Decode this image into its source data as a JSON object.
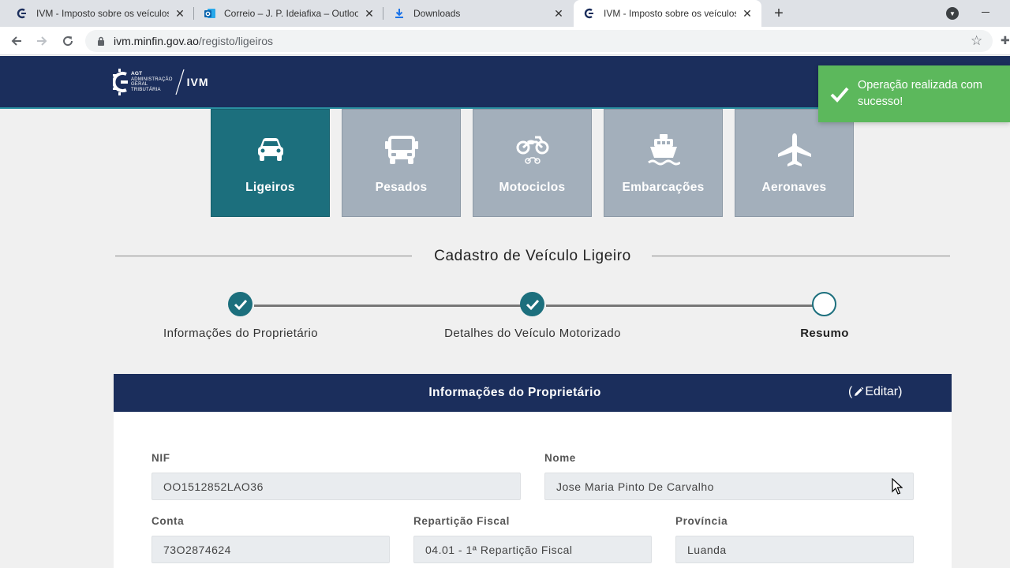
{
  "browser": {
    "tabs": [
      {
        "title": "IVM - Imposto sobre os veículos",
        "icon": "site-favicon",
        "active": false
      },
      {
        "title": "Correio – J. P. Ideiafixa – Outlook",
        "icon": "outlook-icon",
        "active": false
      },
      {
        "title": "Downloads",
        "icon": "download-icon",
        "active": false
      },
      {
        "title": "IVM - Imposto sobre os veículos",
        "icon": "site-favicon",
        "active": true
      }
    ],
    "url_host": "ivm.minfin.gov.ao",
    "url_path": "/registo/ligeiros"
  },
  "header": {
    "logo_abbr": "AGT",
    "logo_lines": [
      "ADMINISTRAÇÃO",
      "GERAL",
      "TRIBUTÁRIA"
    ],
    "app_name": "IVM"
  },
  "toast": {
    "message": "Operação realizada com sucesso!",
    "color": "#5cb85c"
  },
  "categories": [
    {
      "label": "Ligeiros",
      "icon": "car-icon",
      "active": true
    },
    {
      "label": "Pesados",
      "icon": "truck-icon",
      "active": false
    },
    {
      "label": "Motociclos",
      "icon": "motorcycle-icon",
      "active": false
    },
    {
      "label": "Embarcações",
      "icon": "ship-icon",
      "active": false
    },
    {
      "label": "Aeronaves",
      "icon": "plane-icon",
      "active": false
    }
  ],
  "section_title": "Cadastro de Veículo Ligeiro",
  "steps": [
    {
      "label": "Informações do Proprietário",
      "status": "done"
    },
    {
      "label": "Detalhes do Veículo Motorizado",
      "status": "done"
    },
    {
      "label": "Resumo",
      "status": "current"
    }
  ],
  "panel": {
    "title": "Informações do Proprietário",
    "edit_label": "Editar",
    "edit_open": "(",
    "edit_close": ")"
  },
  "fields": {
    "nif": {
      "label": "NIF",
      "value": "OO1512852LAO36"
    },
    "nome": {
      "label": "Nome",
      "value": "Jose Maria Pinto De Carvalho"
    },
    "conta": {
      "label": "Conta",
      "value": "73O2874624"
    },
    "reparticao": {
      "label": "Repartição Fiscal",
      "value": "04.01 - 1ª Repartição Fiscal"
    },
    "provincia": {
      "label": "Província",
      "value": "Luanda"
    }
  },
  "colors": {
    "brand_navy": "#1b2e5c",
    "accent_teal": "#1c6f7d",
    "card_inactive": "#a3afbb"
  }
}
